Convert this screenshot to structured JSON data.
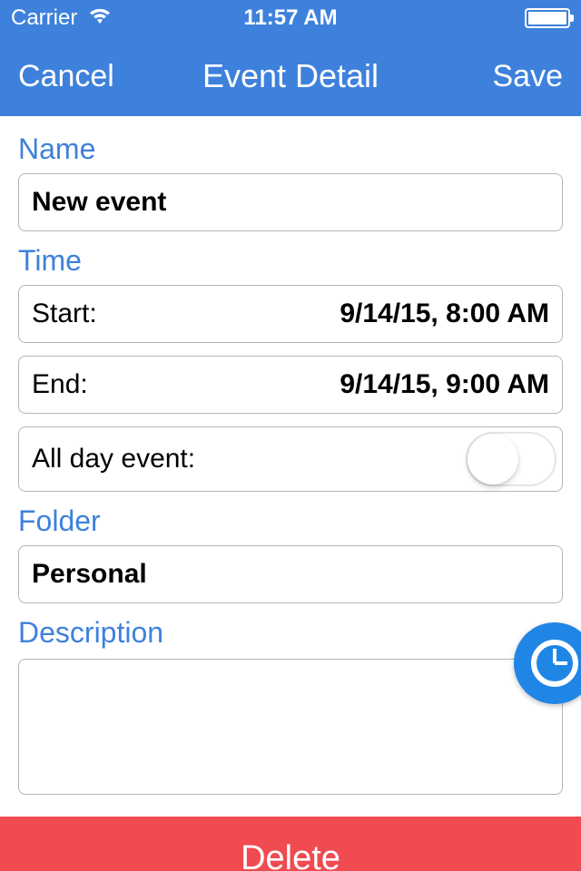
{
  "statusBar": {
    "carrier": "Carrier",
    "time": "11:57 AM"
  },
  "nav": {
    "cancel": "Cancel",
    "title": "Event Detail",
    "save": "Save"
  },
  "sections": {
    "name": {
      "label": "Name",
      "value": "New event"
    },
    "time": {
      "label": "Time",
      "startLabel": "Start:",
      "startValue": "9/14/15, 8:00 AM",
      "endLabel": "End:",
      "endValue": "9/14/15, 9:00 AM",
      "allDayLabel": "All day event:",
      "allDayValue": false
    },
    "folder": {
      "label": "Folder",
      "value": "Personal"
    },
    "description": {
      "label": "Description",
      "value": ""
    }
  },
  "deleteLabel": "Delete"
}
